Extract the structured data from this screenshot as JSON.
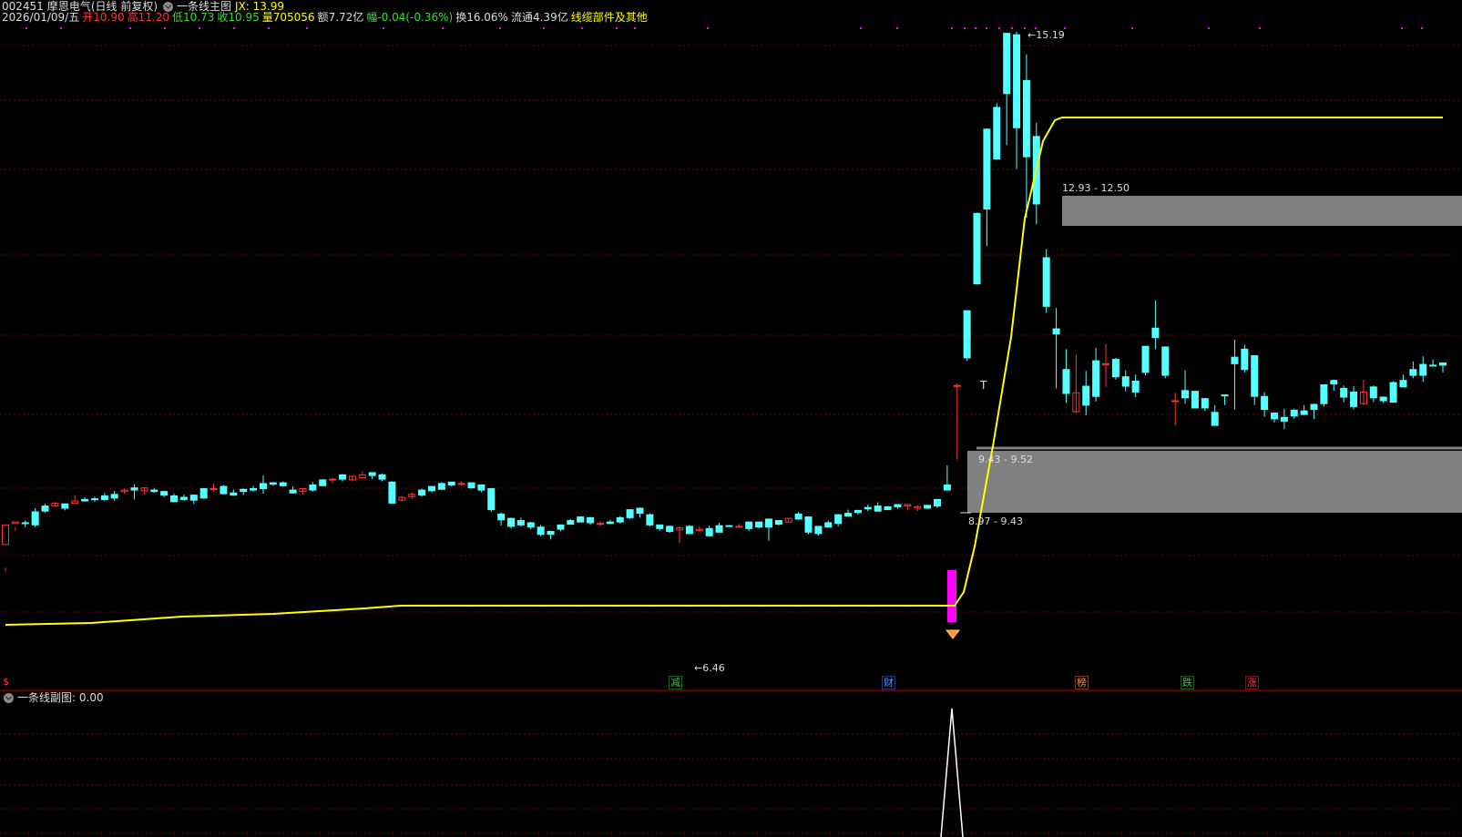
{
  "header": {
    "code": "002451",
    "name": "摩恩电气",
    "period": "(日线 前复权)",
    "indicator_name": "一条线主图",
    "jx_label": "JX: 13.99"
  },
  "quote": {
    "date": "2026/01/09/五",
    "open_label": "开",
    "open": "10.90",
    "high_label": "高",
    "high": "11.20",
    "low_label": "低",
    "low": "10.73",
    "close_label": "收",
    "close": "10.95",
    "volume_label": "量",
    "volume": "705056",
    "amount_label": "额",
    "amount": "7.72亿",
    "change_label": "幅",
    "change": "-0.04(-0.36%)",
    "turnover_label": "换",
    "turnover": "16.06%",
    "float_label": "流通",
    "float": "4.39亿",
    "sector": "线缆部件及其他"
  },
  "price_labels": {
    "high_mark": "15.19",
    "low_mark": "6.46",
    "zone_upper": "12.93 - 12.50",
    "zone_lower_1": "9.43 - 9.52",
    "zone_lower_2": "8.97 - 9.43",
    "t_mark": "T"
  },
  "event_markers": [
    {
      "text": "$",
      "color": "#ff3333"
    },
    {
      "text": "减",
      "color": "#33cc33"
    },
    {
      "text": "财",
      "color": "#5599ff"
    },
    {
      "text": "榜",
      "color": "#ff8833"
    },
    {
      "text": "跌",
      "color": "#33cc33"
    },
    {
      "text": "涨",
      "color": "#ff3333"
    }
  ],
  "sub_chart": {
    "title": "一条线副图",
    "value": ": 0.00"
  },
  "colors": {
    "up": "#ff3232",
    "down": "#54ffff",
    "ma_line": "#ffff00",
    "grid": "#8b0000",
    "signal_bar": "#ff00ff",
    "zone": "#808080"
  },
  "candles": [
    [
      8.13,
      8.4,
      7.76,
      7.81
    ],
    [
      8.42,
      8.44,
      8.32,
      8.37
    ],
    [
      8.43,
      8.42,
      8.37,
      8.46
    ],
    [
      8.58,
      8.4,
      8.37,
      8.63
    ],
    [
      8.66,
      8.59,
      8.57,
      8.69
    ],
    [
      8.66,
      8.7,
      8.65,
      8.71
    ],
    [
      8.69,
      8.63,
      8.6,
      8.69
    ],
    [
      8.7,
      8.73,
      8.72,
      8.81
    ],
    [
      8.75,
      8.73,
      8.72,
      8.78
    ],
    [
      8.76,
      8.75,
      8.72,
      8.79
    ],
    [
      8.8,
      8.75,
      8.73,
      8.84
    ],
    [
      8.82,
      8.77,
      8.73,
      8.87
    ],
    [
      8.86,
      8.88,
      8.83,
      8.9
    ],
    [
      8.91,
      8.88,
      8.75,
      8.96
    ],
    [
      8.87,
      8.91,
      8.82,
      8.92
    ],
    [
      8.88,
      8.86,
      8.84,
      8.91
    ],
    [
      8.86,
      8.81,
      8.78,
      8.87
    ],
    [
      8.8,
      8.72,
      8.71,
      8.83
    ],
    [
      8.78,
      8.75,
      8.73,
      8.82
    ],
    [
      8.81,
      8.74,
      8.69,
      8.82
    ],
    [
      8.9,
      8.77,
      8.76,
      8.9
    ],
    [
      8.9,
      8.9,
      8.86,
      8.97
    ],
    [
      8.93,
      8.83,
      8.83,
      8.95
    ],
    [
      8.84,
      8.81,
      8.8,
      8.89
    ],
    [
      8.89,
      8.86,
      8.81,
      8.9
    ],
    [
      8.9,
      8.88,
      8.86,
      8.94
    ],
    [
      8.97,
      8.9,
      8.83,
      9.08
    ],
    [
      8.98,
      8.96,
      8.94,
      8.99
    ],
    [
      8.98,
      8.94,
      8.93,
      9.0
    ],
    [
      8.88,
      8.84,
      8.83,
      8.93
    ],
    [
      8.86,
      8.9,
      8.82,
      8.91
    ],
    [
      8.95,
      8.88,
      8.86,
      8.99
    ],
    [
      9.02,
      8.94,
      8.94,
      9.03
    ],
    [
      9.02,
      9.03,
      8.97,
      9.05
    ],
    [
      9.09,
      9.03,
      9.0,
      9.1
    ],
    [
      9.02,
      9.07,
      9.0,
      9.08
    ],
    [
      9.05,
      9.09,
      9.08,
      9.14
    ],
    [
      9.12,
      9.08,
      9.03,
      9.12
    ],
    [
      9.09,
      9.03,
      9.0,
      9.11
    ],
    [
      8.99,
      8.7,
      8.69,
      9.0
    ],
    [
      8.74,
      8.78,
      8.72,
      8.8
    ],
    [
      8.79,
      8.82,
      8.76,
      8.85
    ],
    [
      8.88,
      8.81,
      8.79,
      8.9
    ],
    [
      8.93,
      8.87,
      8.85,
      8.93
    ],
    [
      8.97,
      8.89,
      8.9,
      8.99
    ],
    [
      8.99,
      8.95,
      8.93,
      8.99
    ],
    [
      8.96,
      8.97,
      8.94,
      9.0
    ],
    [
      8.98,
      8.91,
      8.9,
      8.98
    ],
    [
      8.95,
      8.88,
      8.85,
      8.95
    ],
    [
      8.9,
      8.61,
      8.58,
      8.91
    ],
    [
      8.55,
      8.47,
      8.39,
      8.57
    ],
    [
      8.49,
      8.38,
      8.35,
      8.5
    ],
    [
      8.46,
      8.4,
      8.38,
      8.5
    ],
    [
      8.43,
      8.37,
      8.34,
      8.44
    ],
    [
      8.37,
      8.27,
      8.24,
      8.4
    ],
    [
      8.31,
      8.27,
      8.2,
      8.32
    ],
    [
      8.4,
      8.34,
      8.31,
      8.4
    ],
    [
      8.46,
      8.41,
      8.4,
      8.48
    ],
    [
      8.51,
      8.44,
      8.44,
      8.52
    ],
    [
      8.5,
      8.43,
      8.4,
      8.5
    ],
    [
      8.41,
      8.42,
      8.39,
      8.45
    ],
    [
      8.44,
      8.42,
      8.41,
      8.47
    ],
    [
      8.5,
      8.44,
      8.42,
      8.52
    ],
    [
      8.61,
      8.5,
      8.48,
      8.61
    ],
    [
      8.63,
      8.56,
      8.5,
      8.64
    ],
    [
      8.54,
      8.4,
      8.38,
      8.56
    ],
    [
      8.4,
      8.35,
      8.32,
      8.4
    ],
    [
      8.38,
      8.31,
      8.29,
      8.39
    ],
    [
      8.33,
      8.36,
      8.15,
      8.38
    ],
    [
      8.38,
      8.28,
      8.28,
      8.4
    ],
    [
      8.32,
      8.34,
      8.31,
      8.38
    ],
    [
      8.35,
      8.25,
      8.24,
      8.39
    ],
    [
      8.39,
      8.3,
      8.29,
      8.43
    ],
    [
      8.39,
      8.38,
      8.38,
      8.4
    ],
    [
      8.38,
      8.38,
      8.37,
      8.41
    ],
    [
      8.44,
      8.35,
      8.32,
      8.44
    ],
    [
      8.44,
      8.37,
      8.35,
      8.44
    ],
    [
      8.48,
      8.37,
      8.18,
      8.49
    ],
    [
      8.46,
      8.41,
      8.39,
      8.46
    ],
    [
      8.44,
      8.49,
      8.43,
      8.5
    ],
    [
      8.55,
      8.48,
      8.47,
      8.58
    ],
    [
      8.51,
      8.3,
      8.27,
      8.52
    ],
    [
      8.38,
      8.28,
      8.25,
      8.38
    ],
    [
      8.43,
      8.37,
      8.37,
      8.46
    ],
    [
      8.54,
      8.42,
      8.38,
      8.55
    ],
    [
      8.56,
      8.52,
      8.53,
      8.61
    ],
    [
      8.6,
      8.57,
      8.54,
      8.6
    ],
    [
      8.64,
      8.62,
      8.59,
      8.68
    ],
    [
      8.66,
      8.59,
      8.58,
      8.71
    ],
    [
      8.65,
      8.61,
      8.62,
      8.66
    ],
    [
      8.68,
      8.65,
      8.62,
      8.68
    ],
    [
      8.66,
      8.68,
      8.6,
      8.68
    ],
    [
      8.63,
      8.65,
      8.59,
      8.67
    ],
    [
      8.67,
      8.63,
      8.62,
      8.67
    ],
    [
      8.75,
      8.66,
      8.63,
      8.75
    ],
    [
      8.95,
      8.88,
      8.88,
      9.22
    ],
    [
      10.32,
      10.32,
      9.3,
      10.35
    ],
    [
      11.35,
      10.7,
      10.66,
      11.35
    ],
    [
      12.69,
      11.72,
      11.71,
      12.7
    ],
    [
      13.85,
      12.75,
      12.24,
      13.86
    ],
    [
      14.15,
      13.44,
      13.43,
      14.21
    ],
    [
      15.17,
      14.34,
      13.63,
      15.17
    ],
    [
      15.15,
      13.87,
      13.3,
      15.19
    ],
    [
      14.52,
      13.47,
      12.63,
      14.88
    ],
    [
      13.75,
      12.82,
      12.54,
      13.94
    ],
    [
      12.08,
      11.41,
      11.32,
      12.2
    ],
    [
      11.1,
      11.03,
      10.28,
      11.39
    ],
    [
      10.54,
      10.21,
      10.08,
      10.82
    ],
    [
      9.96,
      10.22,
      9.94,
      10.75
    ],
    [
      10.31,
      10.05,
      9.91,
      10.52
    ],
    [
      10.66,
      10.17,
      10.1,
      10.84
    ],
    [
      10.62,
      10.62,
      10.3,
      10.89
    ],
    [
      10.68,
      10.44,
      10.4,
      10.7
    ],
    [
      10.44,
      10.31,
      10.24,
      10.53
    ],
    [
      10.38,
      10.23,
      10.16,
      10.47
    ],
    [
      10.86,
      10.5,
      10.46,
      10.86
    ],
    [
      11.11,
      10.98,
      10.82,
      11.49
    ],
    [
      10.85,
      10.46,
      10.42,
      10.86
    ],
    [
      10.1,
      10.11,
      9.77,
      10.22
    ],
    [
      10.25,
      10.15,
      10.07,
      10.53
    ],
    [
      10.24,
      10.01,
      10.01,
      10.24
    ],
    [
      10.14,
      10.01,
      9.97,
      10.07
    ],
    [
      9.95,
      9.77,
      9.77,
      10.05
    ],
    [
      10.19,
      10.18,
      10.05,
      10.19
    ],
    [
      10.71,
      10.62,
      9.99,
      10.95
    ],
    [
      10.82,
      10.54,
      10.5,
      10.88
    ],
    [
      10.73,
      10.17,
      10.05,
      10.6
    ],
    [
      10.17,
      9.99,
      9.89,
      10.23
    ],
    [
      9.94,
      9.86,
      9.81,
      9.95
    ],
    [
      9.88,
      9.83,
      9.72,
      10.0
    ],
    [
      9.98,
      9.9,
      9.86,
      10.0
    ],
    [
      9.97,
      9.92,
      9.93,
      10.05
    ],
    [
      10.06,
      9.99,
      9.86,
      10.07
    ],
    [
      10.33,
      10.07,
      10.03,
      10.32
    ],
    [
      10.39,
      10.34,
      10.25,
      10.4
    ],
    [
      10.28,
      10.16,
      10.09,
      10.32
    ],
    [
      10.23,
      10.03,
      9.99,
      10.31
    ],
    [
      10.07,
      10.23,
      10.05,
      10.4
    ],
    [
      10.3,
      10.15,
      10.09,
      10.32
    ],
    [
      10.16,
      10.11,
      10.08,
      10.17
    ],
    [
      10.36,
      10.09,
      10.12,
      10.38
    ],
    [
      10.39,
      10.3,
      10.3,
      10.47
    ],
    [
      10.54,
      10.46,
      10.42,
      10.65
    ],
    [
      10.61,
      10.46,
      10.37,
      10.72
    ],
    [
      10.6,
      10.59,
      10.59,
      10.68
    ],
    [
      10.63,
      10.6,
      10.5,
      10.62
    ]
  ]
}
